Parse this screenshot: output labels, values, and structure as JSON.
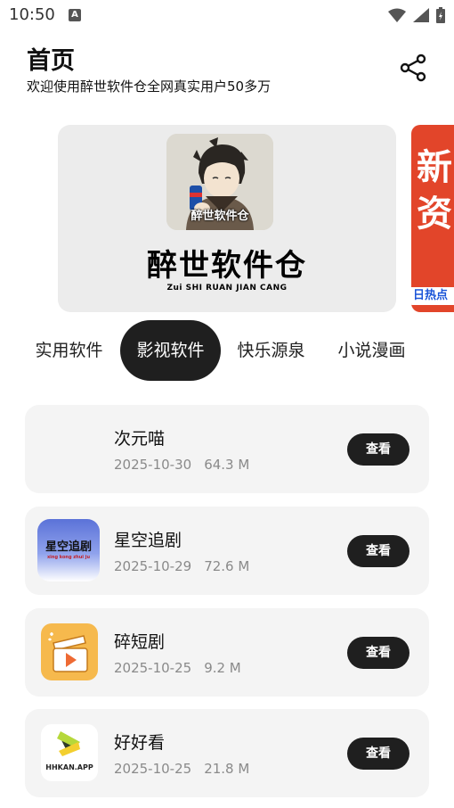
{
  "status_bar": {
    "time": "10:50",
    "notification_badge": "A"
  },
  "header": {
    "title": "首页",
    "subtitle": "欢迎使用醉世软件仓全网真实用户50多万"
  },
  "banner": {
    "avatar_caption": "醉世软件仓",
    "title": "醉世软件仓",
    "subtitle": "Zui SHI RUAN JIAN CANG",
    "next_peek_text": "新\n资",
    "next_peek_footer": "日热点"
  },
  "tabs": [
    {
      "label": "实用软件",
      "active": false
    },
    {
      "label": "影视软件",
      "active": true
    },
    {
      "label": "快乐源泉",
      "active": false
    },
    {
      "label": "小说漫画",
      "active": false
    }
  ],
  "apps": [
    {
      "name": "次元喵",
      "date": "2025-10-30",
      "size": "64.3 M",
      "button": "查看",
      "icon": "blank-icon"
    },
    {
      "name": "星空追剧",
      "date": "2025-10-29",
      "size": "72.6 M",
      "button": "查看",
      "icon": "star-drama-icon",
      "icon_caption": "星空追剧",
      "icon_sub": "xing kong zhui ju"
    },
    {
      "name": "碎短剧",
      "date": "2025-10-25",
      "size": "9.2 M",
      "button": "查看",
      "icon": "clapper-play-icon"
    },
    {
      "name": "好好看",
      "date": "2025-10-25",
      "size": "21.8 M",
      "button": "查看",
      "icon": "hhkan-icon",
      "icon_caption": "HHKAN.APP"
    }
  ],
  "colors": {
    "accent": "#1f1f1f",
    "card_bg": "#f4f4f4",
    "banner_bg": "#ececec",
    "meta_text": "#8a8a8a"
  }
}
